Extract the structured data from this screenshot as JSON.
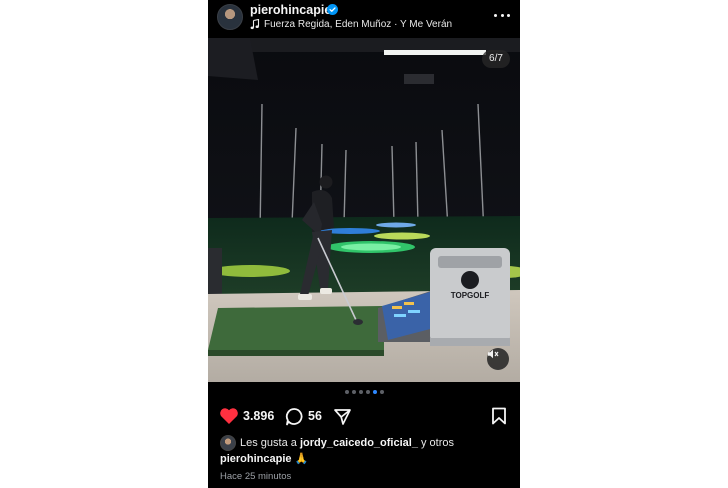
{
  "post": {
    "username": "pierohincapie",
    "audio": "Fuerza Regida, Eden Muñoz · Y Me Verán",
    "counter": "6/7",
    "brand_sign": "TOPGOLF",
    "likes_count": "3.896",
    "comments_count": "56",
    "likes_prefix": "Les gusta a",
    "liked_by_user": "jordy_caicedo_oficial_",
    "likes_suffix": "y otros",
    "caption_user": "pierohincapie",
    "caption_emoji": "🙏",
    "time_ago": "Hace 25 minutos"
  },
  "carousel": {
    "count": 6,
    "active_index": 4
  },
  "icons": {
    "verified": "verified-badge-icon",
    "music": "music-note-icon",
    "more": "more-options-icon",
    "like": "heart-icon",
    "comment": "comment-icon",
    "share": "share-icon",
    "save": "bookmark-icon",
    "mute": "muted-speaker-icon"
  },
  "colors": {
    "like": "#ff3040",
    "verified": "#0095f6",
    "active_dot": "#2d88ff"
  }
}
